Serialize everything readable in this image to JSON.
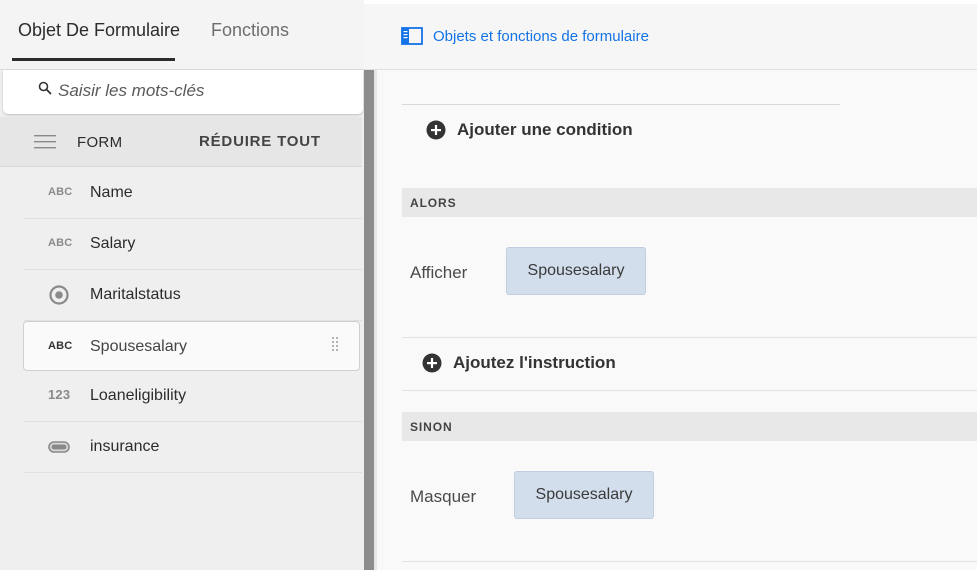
{
  "left_panel": {
    "tabs": [
      {
        "label": "Objet De Formulaire",
        "active": true
      },
      {
        "label": "Fonctions",
        "active": false
      }
    ],
    "search": {
      "placeholder": "Saisir les mots-clés",
      "value": ""
    },
    "tree_header": {
      "label": "FORM",
      "collapse_all_label": "RÉDUIRE TOUT"
    },
    "items": [
      {
        "type_icon": "ABC",
        "label": "Name",
        "icon": "text-field-icon"
      },
      {
        "type_icon": "ABC",
        "label": "Salary",
        "icon": "text-field-icon"
      },
      {
        "type_icon": "",
        "label": "Maritalstatus",
        "icon": "radio-button-icon"
      },
      {
        "type_icon": "ABC",
        "label": "Spousesalary",
        "icon": "text-field-icon",
        "selected": true
      },
      {
        "type_icon": "123",
        "label": "Loaneligibility",
        "icon": "numeric-field-icon"
      },
      {
        "type_icon": "",
        "label": "insurance",
        "icon": "toggle-switch-icon"
      }
    ]
  },
  "right_panel": {
    "header_link": "Objets et fonctions de formulaire",
    "add_condition_label": "Ajouter une condition",
    "then_section": {
      "title": "ALORS",
      "action": "Afficher",
      "target": "Spousesalary"
    },
    "add_statement_label": "Ajoutez l'instruction",
    "else_section": {
      "title": "SINON",
      "action": "Masquer",
      "target": "Spousesalary"
    }
  },
  "colors": {
    "accent": "#1473e6",
    "chip_background": "#d3deed",
    "splitter": "#8c8c8c"
  }
}
